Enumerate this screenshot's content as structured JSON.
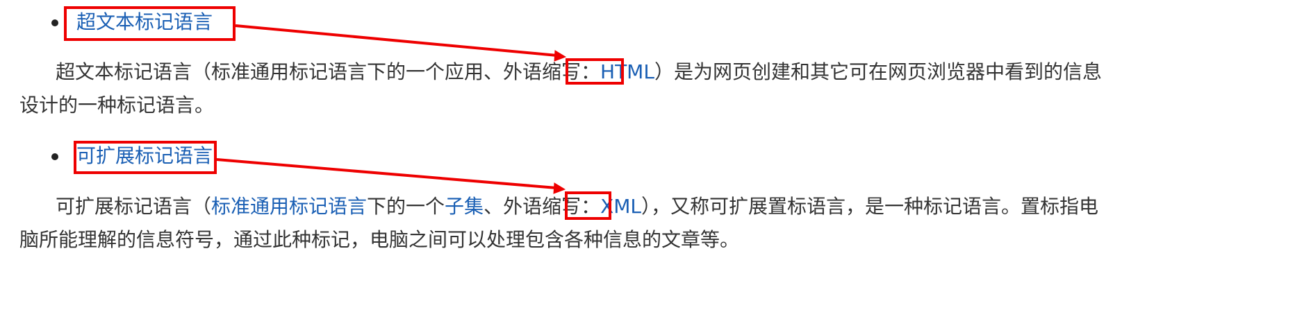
{
  "section_html": {
    "title_link": "超文本标记语言",
    "line1_pre": "超文本标记语言（标准通用标记语言下的一个应用、外语缩写：",
    "line1_link": "HTML",
    "line1_post": "）是为网页创建和其它可在网页浏览器中看到的信息",
    "line2": "设计的一种标记语言。"
  },
  "section_xml": {
    "title_link": "可扩展标记语言",
    "line1_pre": "可扩展标记语言（",
    "line1_link_a": "标准通用标记语言",
    "line1_mid": "下的一个",
    "line1_link_b": "子集",
    "line1_mid2": "、外语缩写：",
    "line1_link_c": "XML",
    "line1_post": "），又称可扩展置标语言，是一种标记语言。置标指电",
    "line2": "脑所能理解的信息符号，通过此种标记，电脑之间可以处理包含各种信息的文章等。"
  },
  "annotation": {
    "color": "#ee0000",
    "link_color": "#1a5fb4"
  }
}
